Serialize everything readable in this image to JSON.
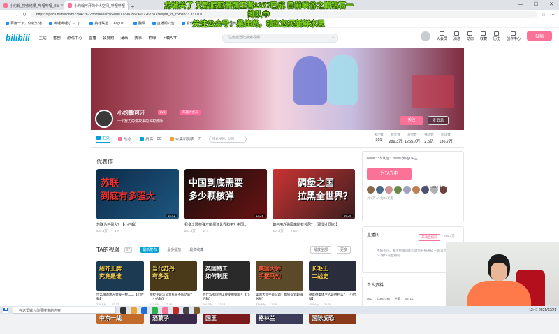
{
  "browser": {
    "tabs": [
      {
        "label": "小约翰_搜索结果_哔哩哔哩_Bili",
        "active": false
      },
      {
        "label": "小约翰可汗的个人空间_哔哩哔哩",
        "active": true
      }
    ],
    "url": "https://space.bilibili.com/23947287?from=searchSeid=17798356749172627873&spm_id_from=333.337.0.0",
    "bookmarks": [
      "百度一下，你就知道",
      "哔哩哔哩 (゜-゜)つ",
      "英雄联盟 - League...",
      "翻译",
      "直播间公告",
      "爱奇艺 - 在线视频",
      "新浪微博"
    ]
  },
  "overlay": {
    "line1": "龙城关了 艾欧尼亚最强王者1277已成 目前峡谷之巅钻石一",
    "line2": "排队中",
    "line3": "关注公众号：黑佳光，领红包买新鲜水果"
  },
  "header": {
    "logo": "bilibili",
    "nav": [
      "主站",
      "番剧",
      "游戏中心",
      "直播",
      "会员购",
      "漫画",
      "赛事",
      "种绿"
    ],
    "download": "下载APP",
    "search_placeholder": "注册后登陆搜索视频",
    "right": [
      "大会员",
      "消息",
      "动态",
      "收藏",
      "历史",
      "创作中心"
    ],
    "upload": "投稿"
  },
  "profile": {
    "name": "小约翰可汗",
    "level_badge": "Lv6",
    "vip_badge": "年度大会员",
    "sign": "一个努力的讲故事的乡村教师",
    "follow": "关注",
    "message": "发消息"
  },
  "tabs": {
    "home": "主页",
    "dynamic": "动态",
    "videos": "投稿",
    "videos_count": "86",
    "collections": "合集和列表",
    "collections_count": "7",
    "search_placeholder": "搜索视频、动态"
  },
  "stats": [
    {
      "label": "关注数",
      "value": "301"
    },
    {
      "label": "粉丝数",
      "value": "289.3万"
    },
    {
      "label": "获赞数",
      "value": "1265.7万"
    },
    {
      "label": "播放数",
      "value": "2.6亿"
    },
    {
      "label": "阅读数",
      "value": "136.7万"
    }
  ],
  "representative": {
    "title": "代表作",
    "items": [
      {
        "thumb": "苏联\n到底有多强大",
        "duration": "14:42",
        "title": "苏联为何强大？【小约翰】",
        "views": "601.4万",
        "date": "4-7"
      },
      {
        "thumb": "中国到底需要\n多少颗核弹",
        "duration": "13:29",
        "title": "我多少颗核弹才能保证世界和平？中国…",
        "views": "254.8万",
        "date": "11-1"
      },
      {
        "thumb": "碉堡之国\n拉黑全世界？",
        "duration": "09:26",
        "title": "如何用炸弹隔离所有邻居？【碉堡小国01】",
        "views": "351.3万",
        "date": "2-10"
      }
    ]
  },
  "videos": {
    "title": "TA的视频",
    "count": "87",
    "sort": [
      "最新发布",
      "最多播放",
      "最多收藏"
    ],
    "play_all": "播放全部",
    "more": "更多",
    "items": [
      {
        "thumb": "绍齐王牌\n究竟是谁",
        "title": "什么样的地方会被一棍二二【小约翰】",
        "views": "228.6万",
        "date": "12-17"
      },
      {
        "thumb": "当代苏丹\n有多强",
        "title": "德拉克是怎么为民局不成功的？【小约翰】",
        "views": "245.8万",
        "date": "12-16"
      },
      {
        "thumb": "英国特工\n如何制压",
        "title": "为什么英国特工要使用钢笔？【小约翰】",
        "views": "291.3万",
        "date": "12-12"
      },
      {
        "thumb": "美国大师\n手搓马勃",
        "title": "美国大师手搓马勃？如何得到超强总统？",
        "views": "374.6万",
        "date": "12-8"
      },
      {
        "thumb": "长毛王\n二战史",
        "title": "德意德集体主人是胜利么？【小约翰】",
        "views": "435.4万",
        "date": "11-30"
      },
      {
        "thumb": "中东一战",
        "title": "",
        "views": "",
        "date": ""
      },
      {
        "thumb": "酒蒙子",
        "title": "",
        "views": "",
        "date": ""
      },
      {
        "thumb": "国王",
        "title": "",
        "views": "",
        "date": ""
      },
      {
        "thumb": "格林兰",
        "title": "",
        "views": "",
        "date": ""
      },
      {
        "thumb": "国际反恐",
        "title": "",
        "views": "",
        "date": ""
      }
    ]
  },
  "side": {
    "charge_intro": "bilibili个人认证：bilibili 知名UP主",
    "charge_button": "为TA充电",
    "charge_count": "共 14812 人",
    "charge_note": "共 1万4A 为TA充电",
    "announce_title": "直播间",
    "announce_btn1": "开通直播间",
    "announce_btn2": "289.3万",
    "announce_text": "主播不在，关注直播间即可收到开播通知 一起来直播吧～ 做TA的直播吧",
    "info_title": "个人资料",
    "uid_label": "UID",
    "uid": "23947287",
    "birthday_label": "生日",
    "birthday": "02-14"
  },
  "taskbar": {
    "search": "在这里输入你要搜索的内容",
    "clock": "12:41 2021/12/21"
  }
}
